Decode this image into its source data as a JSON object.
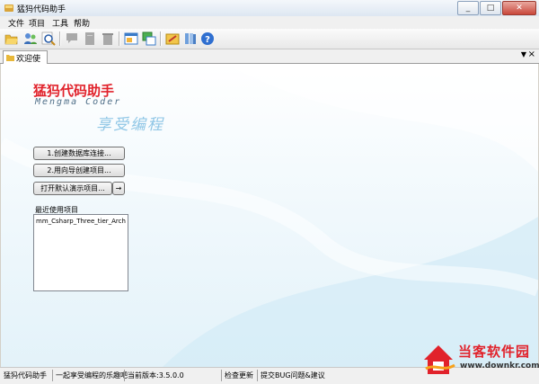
{
  "window": {
    "title": "猛犸代码助手"
  },
  "menu": {
    "items": [
      "文件",
      "项目",
      "工具",
      "帮助"
    ]
  },
  "toolbar": {
    "icons": [
      "open-folder-icon",
      "users-icon",
      "search-icon",
      "comment-icon",
      "document-icon",
      "trash-icon",
      "database-window-icon",
      "database-export-icon",
      "edit-note-icon",
      "books-icon",
      "help-icon"
    ]
  },
  "tab": {
    "label": "欢迎使用"
  },
  "welcome": {
    "logo_cn": "猛犸代码助手",
    "logo_en": "Mengma Coder",
    "slogan": "享受编程",
    "btn_create_db": "1.创建数据库连接...",
    "btn_wizard": "2.用向导创建项目...",
    "btn_open_demo": "打开默认演示项目...",
    "btn_arrow": "→",
    "recent_label": "最近使用项目",
    "recent_items": [
      "mm_Csharp_Three_tier_Architect"
    ]
  },
  "status": {
    "app_name": "猛犸代码助手",
    "motto": "一起享受编程的乐趣吧",
    "version": "当前版本:3.5.0.0",
    "check_update": "检查更新",
    "submit_bug": "提交BUG问题&建议"
  },
  "watermark": {
    "text": "当客软件园",
    "url": "www.downkr.com"
  },
  "colors": {
    "accent": "#e1222b",
    "content_bg": "#e3f2f9"
  }
}
